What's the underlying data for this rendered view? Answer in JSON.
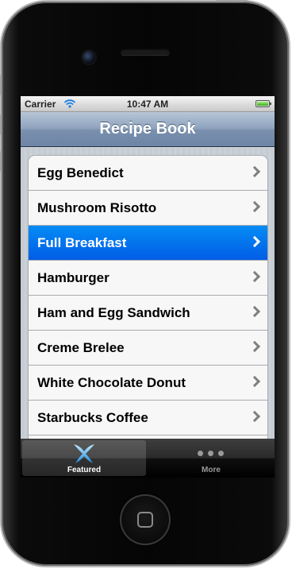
{
  "status_bar": {
    "carrier": "Carrier",
    "time": "10:47 AM",
    "wifi_icon": "wifi-icon",
    "battery_icon": "battery-icon",
    "battery_level": 1.0
  },
  "nav_bar": {
    "title": "Recipe Book"
  },
  "recipes": [
    {
      "label": "Egg Benedict",
      "selected": false
    },
    {
      "label": "Mushroom Risotto",
      "selected": false
    },
    {
      "label": "Full Breakfast",
      "selected": true
    },
    {
      "label": "Hamburger",
      "selected": false
    },
    {
      "label": "Ham and Egg Sandwich",
      "selected": false
    },
    {
      "label": "Creme Brelee",
      "selected": false
    },
    {
      "label": "White Chocolate Donut",
      "selected": false
    },
    {
      "label": "Starbucks Coffee",
      "selected": false
    },
    {
      "label": "",
      "selected": false
    }
  ],
  "tab_bar": {
    "tabs": [
      {
        "label": "Featured",
        "icon": "featured-icon",
        "active": true
      },
      {
        "label": "More",
        "icon": "more-icon",
        "active": false
      }
    ]
  },
  "colors": {
    "selection": "#0a6ff0",
    "nav_bar": "#7a90ae",
    "grouped_background": "#c5ccd4"
  }
}
